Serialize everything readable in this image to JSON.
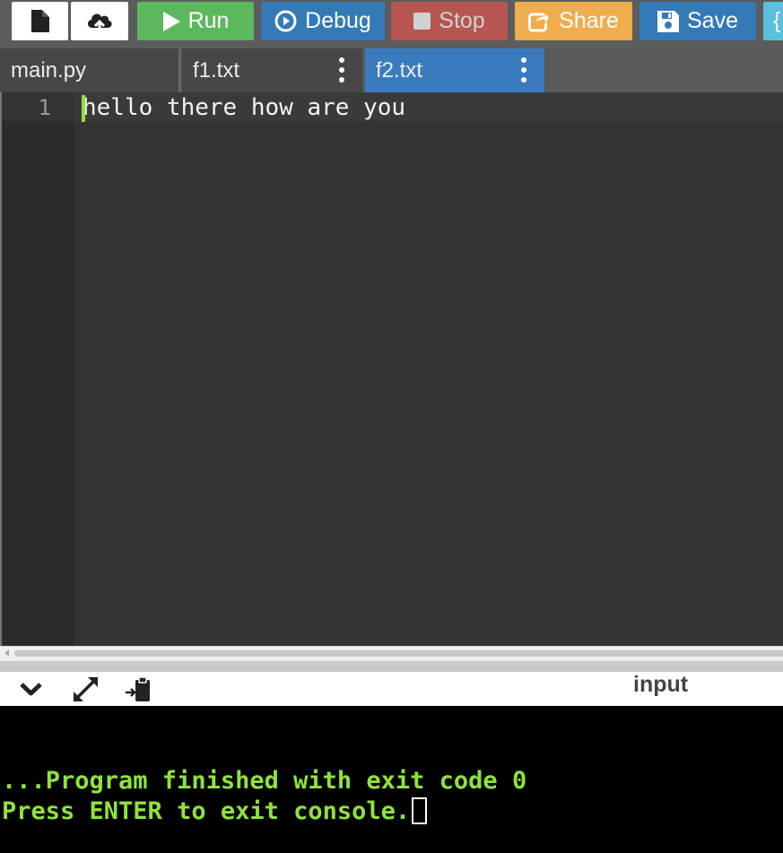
{
  "toolbar": {
    "run_label": "Run",
    "debug_label": "Debug",
    "stop_label": "Stop",
    "share_label": "Share",
    "save_label": "Save",
    "beautify_label": "{",
    "colors": {
      "run": "#5cb85c",
      "debug": "#337ab7",
      "stop": "#d9534f",
      "share": "#f0ad4e",
      "save": "#337ab7",
      "beautify": "#5bc0de"
    }
  },
  "tabs": [
    {
      "name": "main.py"
    },
    {
      "name": "f1.txt"
    },
    {
      "name": "f2.txt",
      "active": true
    }
  ],
  "editor": {
    "lines": [
      {
        "number": "1",
        "text": "hello there how are you"
      }
    ]
  },
  "console_bar": {
    "input_label": "input",
    "icons": [
      "chevron-down-icon",
      "expand-icon",
      "clipboard-icon"
    ]
  },
  "console": {
    "lines": [
      "...Program finished with exit code 0",
      "Press ENTER to exit console."
    ]
  }
}
